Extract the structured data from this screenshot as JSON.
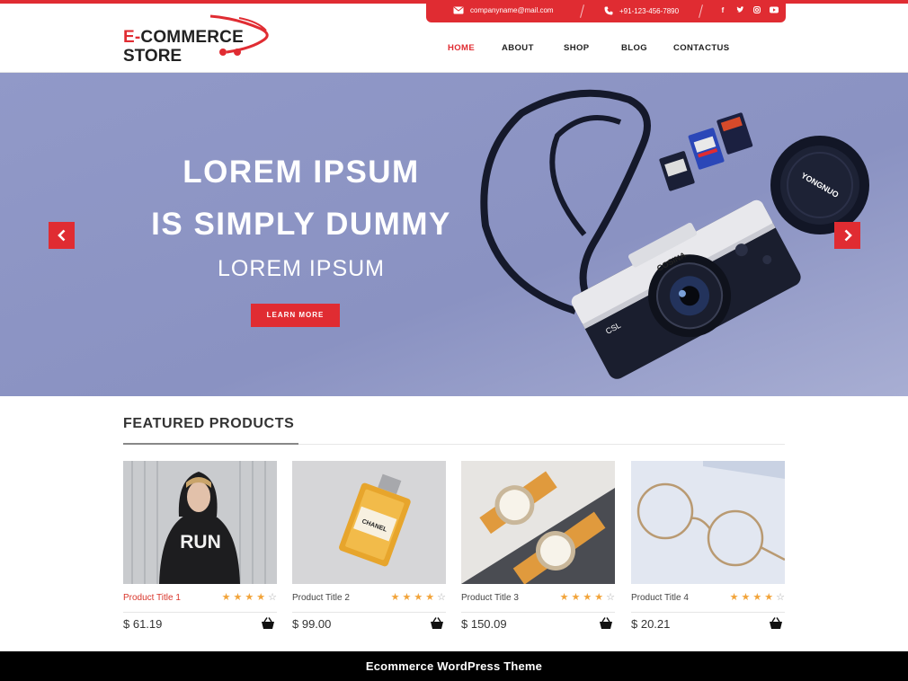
{
  "contact": {
    "email": "companyname@mail.com",
    "phone": "+91-123-456-7890",
    "social": [
      "facebook-icon",
      "twitter-icon",
      "instagram-icon",
      "youtube-icon"
    ]
  },
  "logo": {
    "line1_prefix": "E-",
    "line1_rest": "COMMERCE",
    "line2": "STORE"
  },
  "nav": [
    {
      "label": "HOME",
      "active": true
    },
    {
      "label": "ABOUT"
    },
    {
      "label": "SHOP"
    },
    {
      "label": "BLOG"
    },
    {
      "label": "CONTACTUS"
    }
  ],
  "hero": {
    "line1": "LOREM IPSUM",
    "line2": "IS SIMPLY DUMMY",
    "line3": "LOREM IPSUM",
    "button": "LEARN MORE",
    "prev_icon": "chevron-left-icon",
    "next_icon": "chevron-right-icon",
    "camera_brand": "COSINA",
    "camera_model": "CSL",
    "lens_cap_brand": "YONGNUO"
  },
  "featured": {
    "title": "FEATURED PRODUCTS",
    "products": [
      {
        "title": "Product Title 1",
        "price": "$ 61.19",
        "rating": 4,
        "hoodie_text": "RUN"
      },
      {
        "title": "Product Title 2",
        "price": "$ 99.00",
        "rating": 4
      },
      {
        "title": "Product Title 3",
        "price": "$ 150.09",
        "rating": 4
      },
      {
        "title": "Product Title 4",
        "price": "$ 20.21",
        "rating": 4
      }
    ]
  },
  "footer": {
    "text": "Ecommerce WordPress Theme"
  },
  "colors": {
    "accent": "#e02c32",
    "hero_bg": "#8b93c3",
    "star": "#f2a43a"
  }
}
